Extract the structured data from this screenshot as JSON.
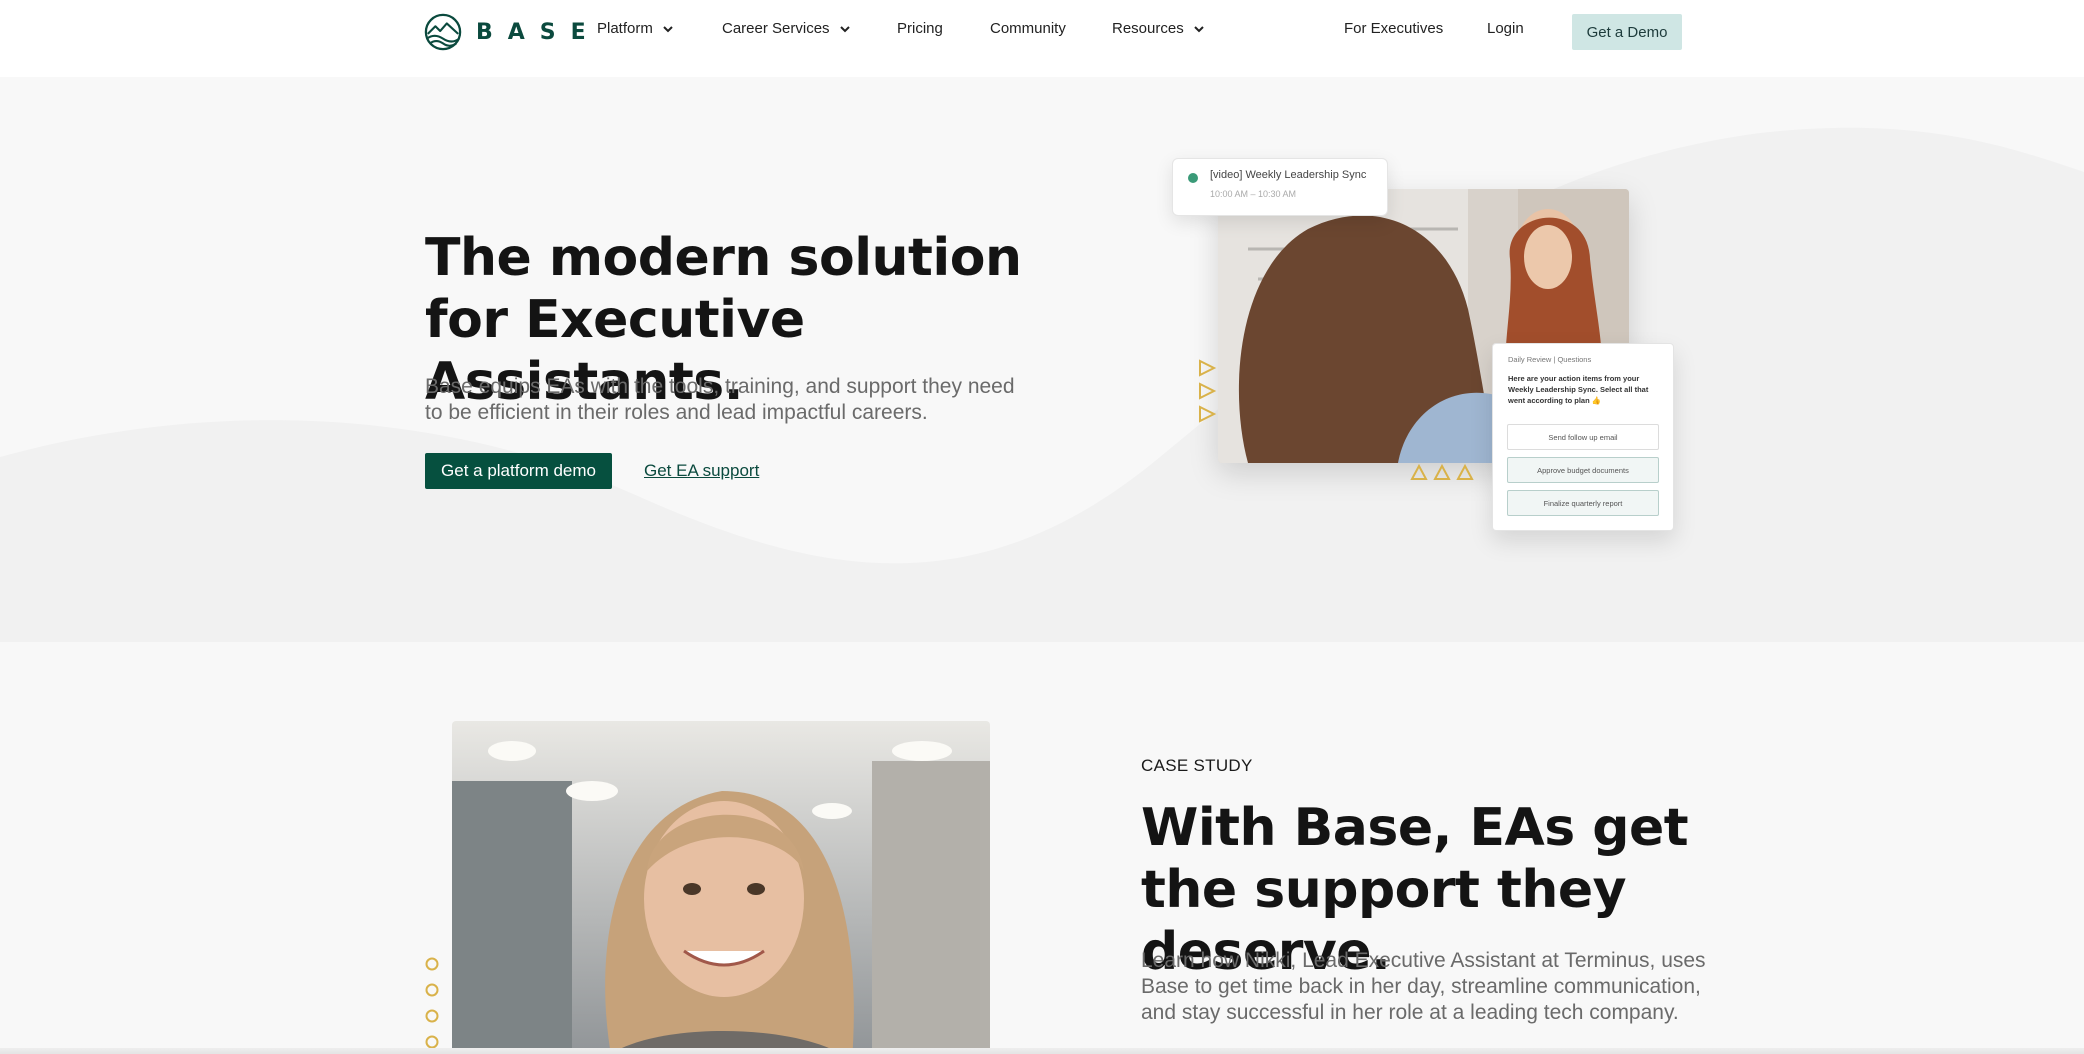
{
  "brand": {
    "name": "BASE",
    "color": "#0b4a3e"
  },
  "nav": {
    "platform": "Platform",
    "career_services": "Career Services",
    "pricing": "Pricing",
    "community": "Community",
    "resources": "Resources",
    "for_executives": "For Executives",
    "login": "Login",
    "demo": "Get a Demo"
  },
  "hero": {
    "title": "The modern solution for Executive Assistants.",
    "description": "Base equips EAs with the tools, training, and support they need to be efficient in their roles and lead impactful careers.",
    "primary_cta": "Get a platform demo",
    "secondary_cta": "Get EA support",
    "meeting_card": {
      "title": "[video] Weekly Leadership Sync",
      "time": "10:00 AM – 10:30 AM"
    },
    "review_card": {
      "header": "Daily Review | Questions",
      "prompt": "Here are your action items from your Weekly Leadership Sync. Select all that went according to plan 👍",
      "options": [
        "Send follow up email",
        "Approve budget documents",
        "Finalize quarterly report"
      ]
    }
  },
  "case_study": {
    "eyebrow": "CASE STUDY",
    "title": "With Base, EAs get the support they deserve.",
    "description": "Learn how Nikki, Lead Executive Assistant at Terminus, uses Base to get time back in her day, streamline communication, and stay successful in her role at a leading tech company."
  },
  "colors": {
    "primary": "#06503f",
    "demo_button_bg": "#cfe6e4",
    "accent_gold": "#d9b24a",
    "section_bg": "#f8f8f8"
  }
}
